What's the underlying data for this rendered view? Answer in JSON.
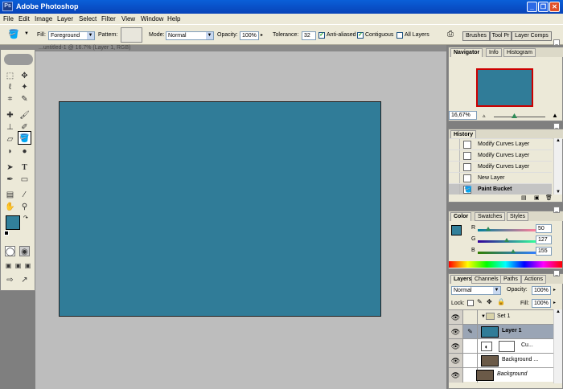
{
  "window": {
    "title": "Adobe Photoshop",
    "minimize": "_",
    "restore": "❐",
    "close": "✕"
  },
  "menu": [
    "File",
    "Edit",
    "Image",
    "Layer",
    "Select",
    "Filter",
    "View",
    "Window",
    "Help"
  ],
  "options": {
    "fill_label": "Fill:",
    "fill_value": "Foreground",
    "pattern_label": "Pattern:",
    "mode_label": "Mode:",
    "mode_value": "Normal",
    "opacity_label": "Opacity:",
    "opacity_value": "100%",
    "tolerance_label": "Tolerance:",
    "tolerance_value": "32",
    "anti_aliased": "Anti-aliased",
    "contiguous": "Contiguous",
    "all_layers": "All Layers",
    "well_tabs": [
      "Brushes",
      "Tool Pr",
      "Layer Comps"
    ]
  },
  "document": {
    "header_text": "...untitled-1 @ 16.7% (Layer 1, RGB)",
    "canvas_color": "#307c98"
  },
  "navigator": {
    "tabs": [
      "Navigator",
      "Info",
      "Histogram"
    ],
    "zoom": "16,67%"
  },
  "history": {
    "tabs": [
      "History"
    ],
    "items": [
      "Modify Curves Layer",
      "Modify Curves Layer",
      "Modify Curves Layer",
      "New Layer",
      "Paint Bucket"
    ]
  },
  "color": {
    "tabs": [
      "Color",
      "Swatches",
      "Styles"
    ],
    "r_label": "R",
    "r_value": "50",
    "g_label": "G",
    "g_value": "127",
    "b_label": "B",
    "b_value": "155",
    "swatch": "#32809b"
  },
  "layers": {
    "tabs": [
      "Layers",
      "Channels",
      "Paths",
      "Actions"
    ],
    "blend_mode": "Normal",
    "opacity_label": "Opacity:",
    "opacity_value": "100%",
    "lock_label": "Lock:",
    "fill_label": "Fill:",
    "fill_value": "100%",
    "rows": [
      "Set 1",
      "Layer 1",
      "Cu...",
      "Background ...",
      "Background"
    ]
  }
}
